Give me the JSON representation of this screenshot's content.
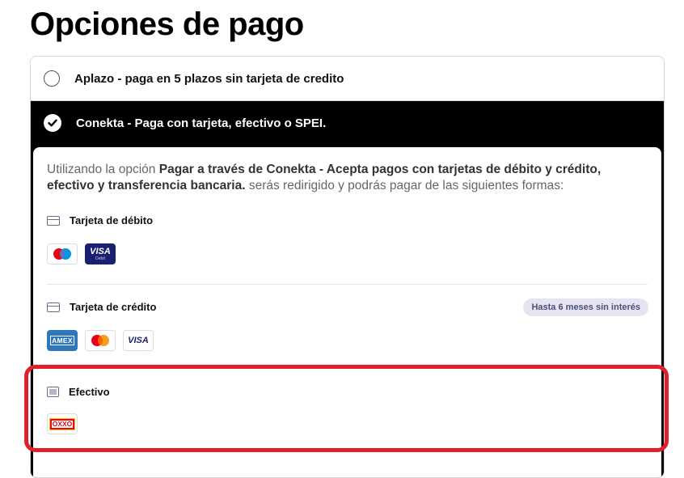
{
  "page": {
    "title": "Opciones de pago"
  },
  "options": {
    "aplazo": {
      "label": "Aplazo - paga en 5 plazos sin tarjeta de credito",
      "selected": false
    },
    "conekta": {
      "label": "Conekta - Paga con tarjeta, efectivo o SPEI.",
      "selected": true
    }
  },
  "details": {
    "intro_prefix": "Utilizando la opción ",
    "intro_bold": "Pagar a través de Conekta - Acepta pagos con tarjetas de débito y crédito, efectivo y transferencia bancaria.",
    "intro_suffix": " serás redirigido y podrás pagar de las siguientes formas:",
    "debit": {
      "title": "Tarjeta de débito",
      "logos": [
        "maestro-logo",
        "visa-debit-logo"
      ],
      "visa_text": "VISA",
      "visa_sub": "Debit"
    },
    "credit": {
      "title": "Tarjeta de crédito",
      "badge": "Hasta 6 meses sin interés",
      "logos": [
        "amex-logo",
        "mastercard-logo",
        "visa-logo"
      ],
      "amex_text": "AMEX",
      "visa_text": "VISA"
    },
    "cash": {
      "title": "Efectivo",
      "logos": [
        "oxxo-logo"
      ],
      "oxxo_text": "OXXO"
    }
  },
  "colors": {
    "selected_bg": "#000000",
    "badge_bg": "#e6e4f3",
    "highlight": "#e0202a",
    "visa_blue": "#1a1f71",
    "amex_blue": "#2e77bb"
  }
}
